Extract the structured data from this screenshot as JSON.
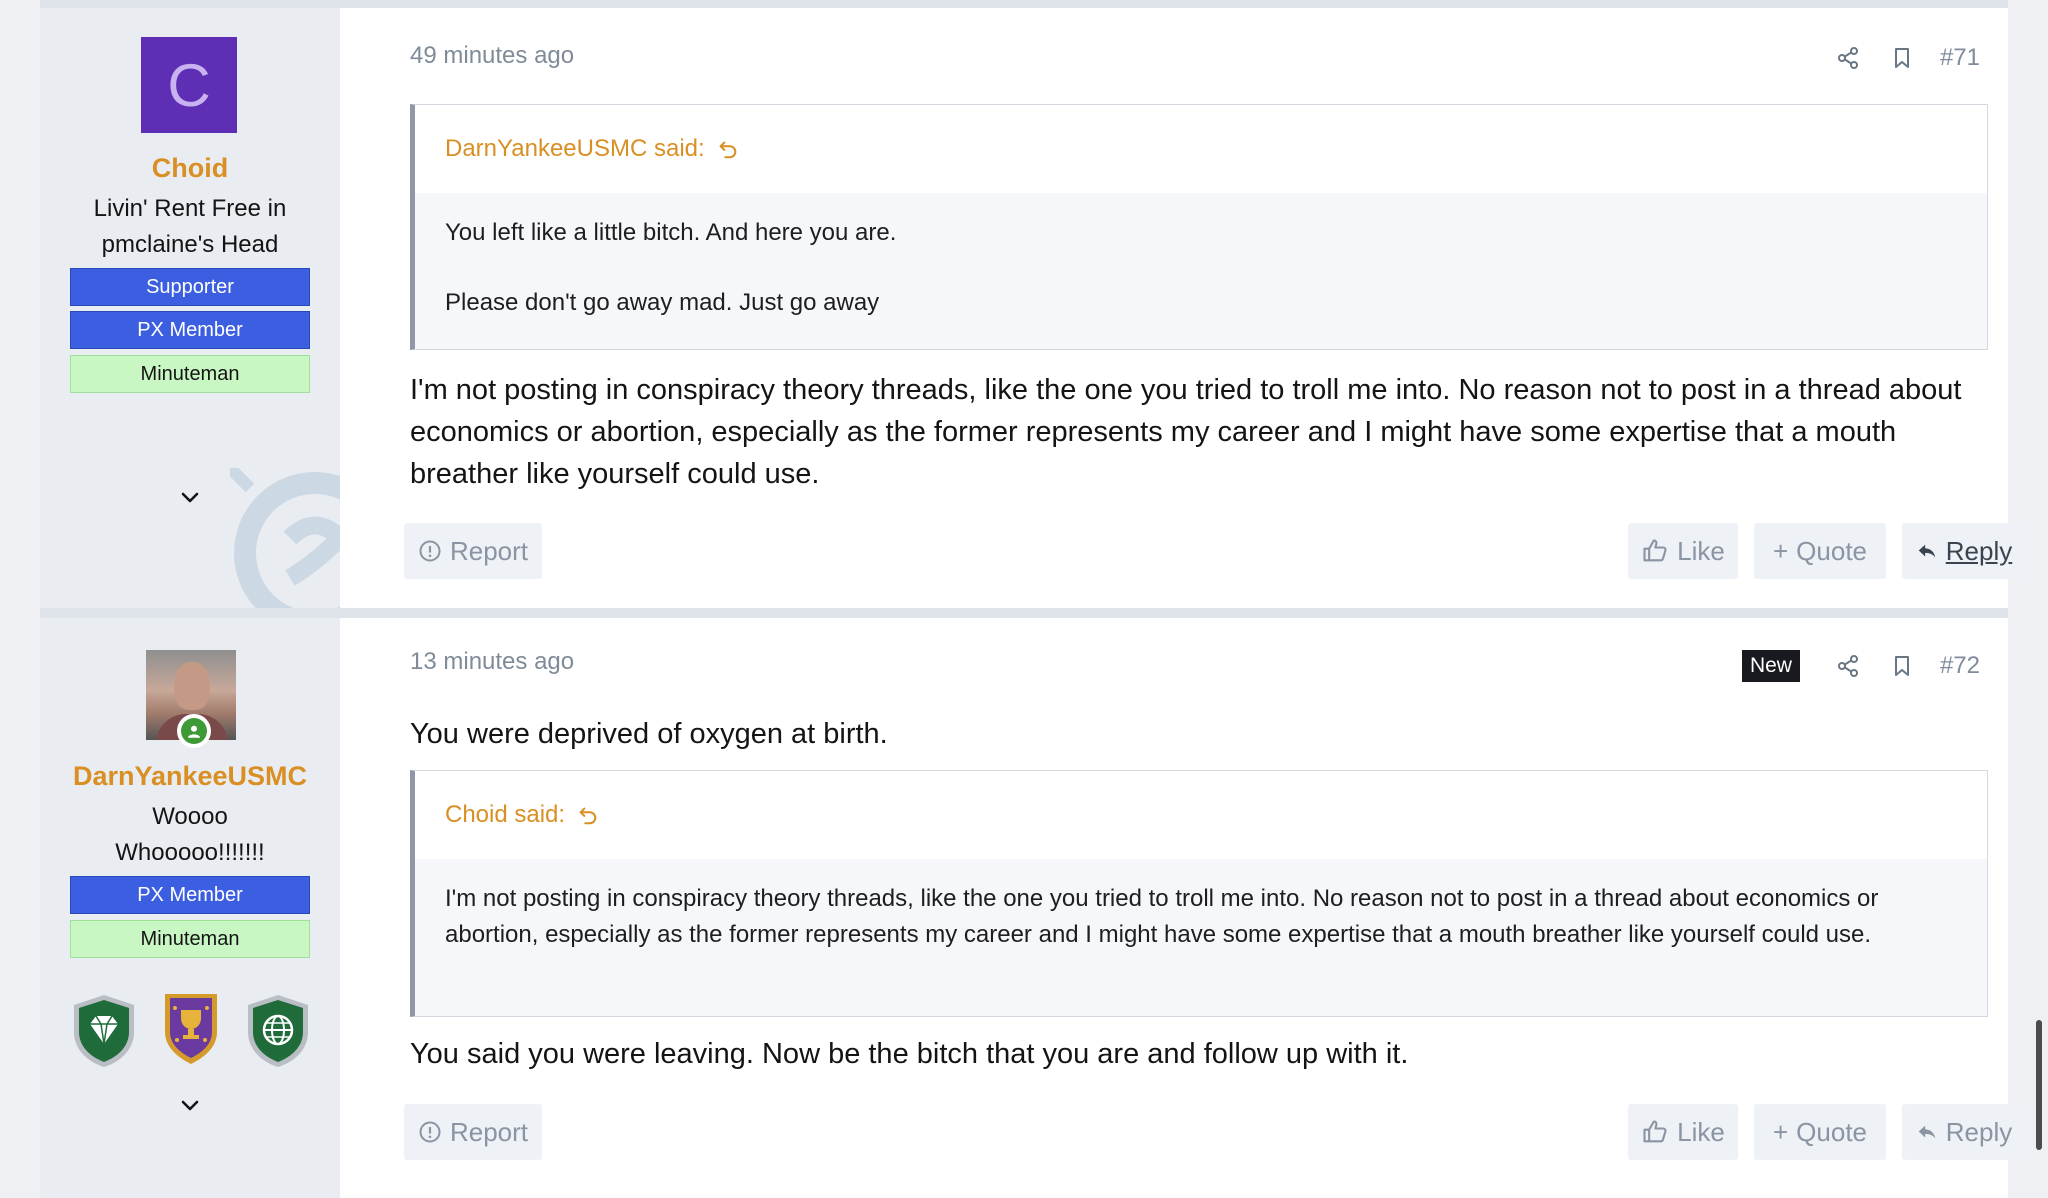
{
  "posts": [
    {
      "user": {
        "avatar_letter": "C",
        "avatar_color": "#5e2fb4",
        "name": "Choid",
        "title_lines": [
          "Livin' Rent Free in",
          "pmclaine's Head"
        ],
        "banners": [
          {
            "label": "Supporter",
            "style": "blue"
          },
          {
            "label": "PX Member",
            "style": "blue"
          },
          {
            "label": "Minuteman",
            "style": "green"
          }
        ]
      },
      "time": "49 minutes ago",
      "number": "#71",
      "quote": {
        "author": "DarnYankeeUSMC said:",
        "lines": [
          "You left like a little bitch. And here you are.",
          "Please don't go away mad. Just go away"
        ]
      },
      "text": "I'm not posting in conspiracy theory threads, like the one you tried to troll me into. No reason not to post in a thread about economics or abortion, especially as the former represents my career and I might have some expertise that a mouth breather like yourself could use.",
      "actions": {
        "report": "Report",
        "like": "Like",
        "quote": "Quote",
        "reply": "Reply"
      }
    },
    {
      "user": {
        "avatar_icon": "user-photo-avatar",
        "name": "DarnYankeeUSMC",
        "title_lines": [
          "Woooo",
          "Whooooo!!!!!!!"
        ],
        "banners": [
          {
            "label": "PX Member",
            "style": "blue"
          },
          {
            "label": "Minuteman",
            "style": "green"
          }
        ],
        "trophies": [
          "diamond-shield-icon",
          "trophy-shield-icon",
          "globe-shield-icon"
        ]
      },
      "time": "13 minutes ago",
      "new_label": "New",
      "number": "#72",
      "intro": "You were deprived of oxygen at birth.",
      "quote": {
        "author": "Choid said:",
        "lines": [
          "I'm not posting in conspiracy theory threads, like the one you tried to troll me into. No reason not to post in a thread about economics or abortion, especially as the former represents my career and I might have some expertise that a mouth breather like yourself could use."
        ]
      },
      "text": "You said you were leaving. Now be the bitch that you are and follow up with it.",
      "actions": {
        "report": "Report",
        "like": "Like",
        "quote": "Quote",
        "reply": "Reply"
      }
    }
  ],
  "colors": {
    "username": "#d98f24",
    "banner_blue": "#3b5fe0",
    "banner_green": "#c8f7c3",
    "muted": "#7f8b99"
  }
}
